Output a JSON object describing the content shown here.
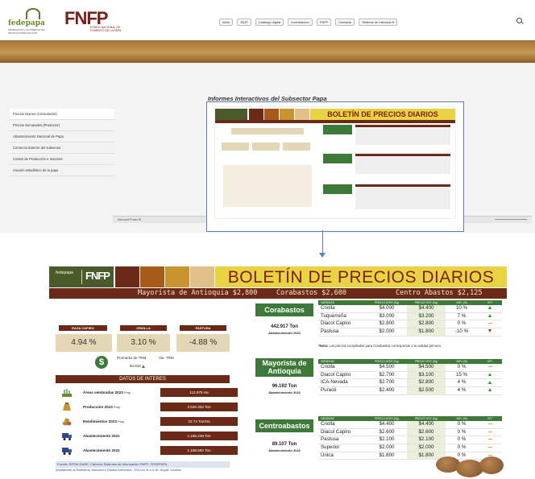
{
  "header": {
    "logo_fede": "fedepapa",
    "logo_fede_sub": "FEDERACIÓN COLOMBIANA DE PRODUCTORES DE PAPA",
    "logo_fnfp": "FNFP",
    "logo_fnfp_sub": "FONDO NACIONAL DE FOMENTO DE LA PAPA",
    "nav": [
      "Inicio",
      "SIUP",
      "Catálogo digital",
      "Investiracion",
      "FNFP",
      "Contacto",
      "Sistema de mercado ▾"
    ]
  },
  "section_title": "Informes Interactivos del Subsector Papa",
  "sidebar": [
    "Precios Diarios (Consumidor)",
    "Precios Semanales (Productor)",
    "Abastecimiento Nacional de Papa",
    "Comercio Exterior del subsector",
    "Costos de Producción e Insumos",
    "Anuario estadístico de la papa"
  ],
  "powerbi_label": "Microsoft Power BI",
  "bulletin": {
    "logo_word": "fedepapa",
    "logo_fn": "FNFP",
    "title": "BOLETÍN DE PRECIOS DIARIOS",
    "strip": {
      "m1": "Mayorista de Antioquia $2,800",
      "m2": "Corabastos $2,600",
      "m3": "Centro Abastos $2,125"
    },
    "pills": [
      "RAZA CAPIRO",
      "CRIOLLA",
      "PASTUSA"
    ],
    "pcts": [
      "4.94 %",
      "3.10 %",
      "-4.88 %"
    ],
    "promedio_label": "Promedio de TRM",
    "var_trm_label": "Var. TRM",
    "trm_value": "$4.632",
    "datos_title": "DATOS DE INTERES",
    "datos": [
      {
        "label": "Áreas sembradas 2023",
        "suffix": "Proy",
        "value": "112.975 Ha"
      },
      {
        "label": "Producción 2023",
        "suffix": "Proy",
        "value": "2.526.332 Ton"
      },
      {
        "label": "Rendimientos 2023",
        "suffix": "Proy",
        "value": "22.74 Ton/Ha"
      },
      {
        "label": "Abastecimiento 2021",
        "suffix": "",
        "value": "1.185.239 Ton"
      },
      {
        "label": "Abastecimiento 2022",
        "suffix": "",
        "value": "1.198.592 Ton"
      }
    ],
    "fuente": "Fuente: SIPSA-DANE. Cálculos Sistemas de Información FNFP- FEDEPAPA",
    "fuente2": "Departamento de Sistemas de Información y Estudios Económicos · 2023 Cra. 31 # 21-60 · Bogotá, Colombia",
    "nota_bold": "*Nota:",
    "nota": " Los precios recopilados para Corabastos corresponde a la calidad primera.",
    "col_headers": [
      "VARIEDAD",
      "PRECIO AYER (Kg)",
      "PRECIO HOY (Kg)",
      "VAR. (%)",
      "KPI"
    ],
    "markets": [
      {
        "name": "Corabastos",
        "ton": "442.917 Ton",
        "abast": "Abastecimiento 2022",
        "rows": [
          {
            "v": "Criolla",
            "ayer": "$4.000",
            "hoy": "$4.400",
            "var": "10 %",
            "kpi": "up"
          },
          {
            "v": "Tuquerreña",
            "ayer": "$3.000",
            "hoy": "$3.200",
            "var": "7 %",
            "kpi": "up"
          },
          {
            "v": "Diacol Capiro",
            "ayer": "$2.800",
            "hoy": "$2.800",
            "var": "0 %",
            "kpi": "flat"
          },
          {
            "v": "Pastusa",
            "ayer": "$2.000",
            "hoy": "$1.800",
            "var": "-10 %",
            "kpi": "down"
          }
        ]
      },
      {
        "name": "Mayorista de Antioquia",
        "ton": "96.192 Ton",
        "abast": "Abastecimiento 2022",
        "rows": [
          {
            "v": "Criolla",
            "ayer": "$4.500",
            "hoy": "$4.500",
            "var": "0 %",
            "kpi": "flat"
          },
          {
            "v": "Diacol Capiro",
            "ayer": "$2.700",
            "hoy": "$3.100",
            "var": "15 %",
            "kpi": "up"
          },
          {
            "v": "ICA-Nevada",
            "ayer": "$2.700",
            "hoy": "$2.800",
            "var": "4 %",
            "kpi": "up"
          },
          {
            "v": "Puracé",
            "ayer": "$2.400",
            "hoy": "$2.500",
            "var": "4 %",
            "kpi": "up"
          }
        ]
      },
      {
        "name": "Centroabastos",
        "ton": "89.107 Ton",
        "abast": "Abastecimiento 2022",
        "rows": [
          {
            "v": "Criolla",
            "ayer": "$4.400",
            "hoy": "$4.400",
            "var": "0 %",
            "kpi": "flat"
          },
          {
            "v": "Diacol Capiro",
            "ayer": "$2.600",
            "hoy": "$2.600",
            "var": "0 %",
            "kpi": "flat"
          },
          {
            "v": "Pastusa",
            "ayer": "$2.100",
            "hoy": "$2.100",
            "var": "0 %",
            "kpi": "flat"
          },
          {
            "v": "Superior",
            "ayer": "$2.000",
            "hoy": "$2.000",
            "var": "0 %",
            "kpi": "flat"
          },
          {
            "v": "Única",
            "ayer": "$1.800",
            "hoy": "$1.800",
            "var": "0 %",
            "kpi": "flat"
          }
        ]
      }
    ],
    "colors": {
      "brown": "#6b2a17",
      "green": "#3d7a3a",
      "yellow": "#e9d342",
      "beige": "#e3d7b5"
    }
  }
}
